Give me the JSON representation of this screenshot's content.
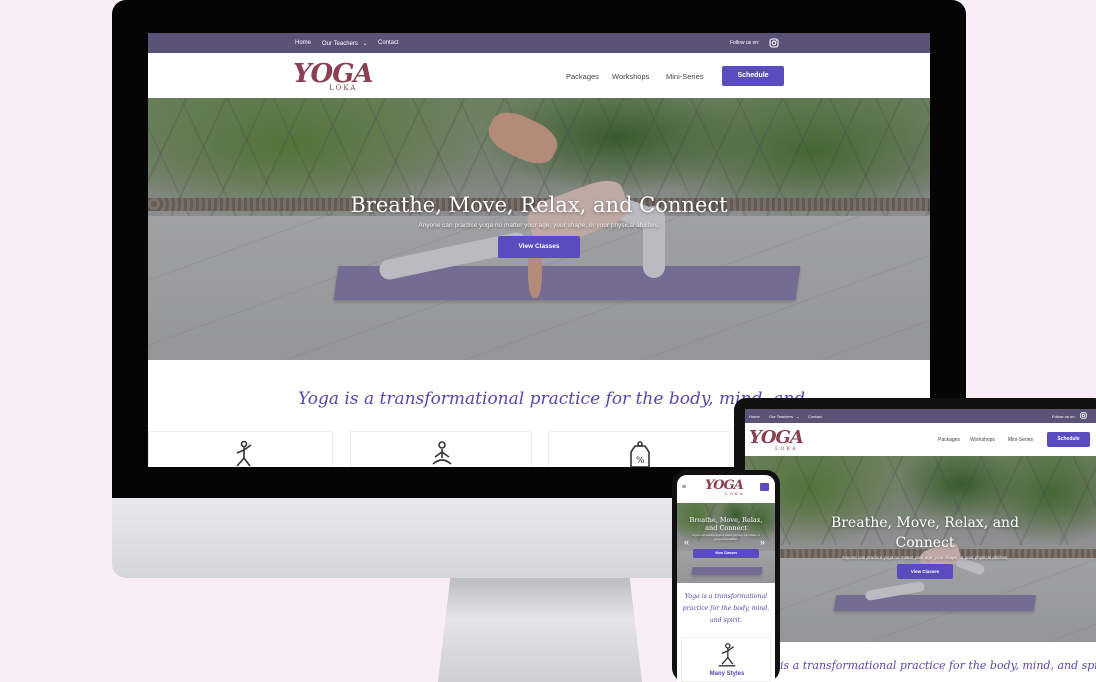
{
  "brand": {
    "logo_main": "YOGA",
    "logo_sub": "LOKA",
    "colors": {
      "purple": "#5a4cbf",
      "topbar": "#5b5278",
      "logo": "#8a3f52",
      "script": "#5548b0"
    }
  },
  "topbar": {
    "links": [
      "Home",
      "Our Teachers",
      "Contact"
    ],
    "follow_label": "Follow us on:",
    "social_icon": "instagram-icon"
  },
  "navbar": {
    "links": [
      "Packages",
      "Workshops",
      "Mini-Series"
    ],
    "cta": "Schedule"
  },
  "hero": {
    "title": "Breathe, Move, Relax, and Connect",
    "title_tablet_line1": "Breathe, Move, Relax, and",
    "title_tablet_line2": "Connect",
    "title_phone_line1": "Breathe, Move, Relax,",
    "title_phone_line2": "and Connect",
    "subtitle": "Anyone can practice yoga no matter your age, your shape, or your physical abilities.",
    "button": "View Classes"
  },
  "tagline": {
    "desktop": "Yoga is a transformational practice for the body, mind, and spirit.",
    "desktop_visible": "Yoga is a transformational practice for the body, mind, and",
    "tablet_visible": "is a transformational practice for the body, mind, and spirit.",
    "phone_line1": "Yoga is a transformational",
    "phone_line2": "practice for the body, mind,",
    "phone_line3": "and spirit."
  },
  "features": {
    "icons": [
      "yoga-pose-icon",
      "meditation-icon",
      "discount-tag-icon"
    ],
    "phone_first_label": "Many Styles"
  }
}
